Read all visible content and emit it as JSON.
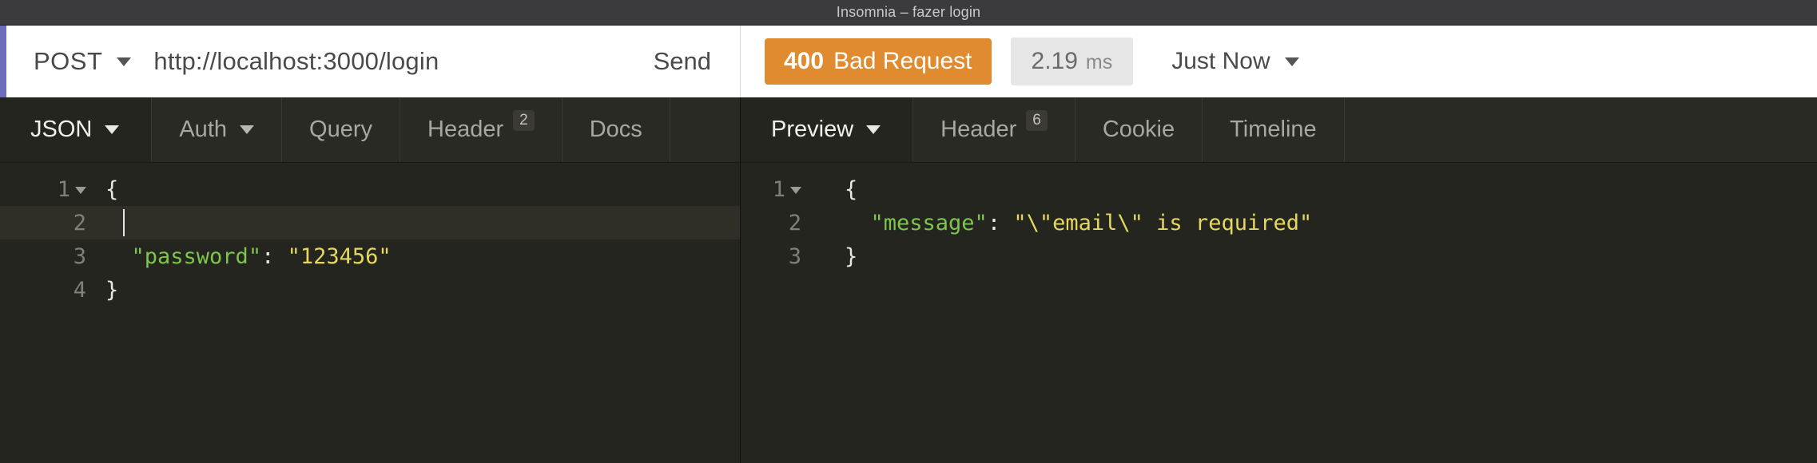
{
  "window": {
    "title": "Insomnia – fazer login"
  },
  "request_bar": {
    "method": "POST",
    "method_caret": "chevron-down-icon",
    "url": "http://localhost:3000/login",
    "send_label": "Send"
  },
  "response_meta": {
    "status_code": "400",
    "status_text": "Bad Request",
    "status_color": "#e08b2f",
    "time_value": "2.19",
    "time_unit": "ms",
    "history_label": "Just Now",
    "history_caret": "chevron-down-icon"
  },
  "request_tabs": [
    {
      "label": "JSON",
      "badge": "",
      "caret": true,
      "active": true
    },
    {
      "label": "Auth",
      "badge": "",
      "caret": true,
      "active": false
    },
    {
      "label": "Query",
      "badge": "",
      "caret": false,
      "active": false
    },
    {
      "label": "Header",
      "badge": "2",
      "caret": false,
      "active": false
    },
    {
      "label": "Docs",
      "badge": "",
      "caret": false,
      "active": false
    }
  ],
  "response_tabs": [
    {
      "label": "Preview",
      "badge": "",
      "caret": true,
      "active": true
    },
    {
      "label": "Header",
      "badge": "6",
      "caret": false,
      "active": false
    },
    {
      "label": "Cookie",
      "badge": "",
      "caret": false,
      "active": false
    },
    {
      "label": "Timeline",
      "badge": "",
      "caret": false,
      "active": false
    }
  ],
  "request_body": {
    "lines": [
      {
        "num": "1",
        "fold": true,
        "active": false,
        "indent": "",
        "open": "{",
        "key": "",
        "colon": "",
        "value": "",
        "cursor": false
      },
      {
        "num": "2",
        "fold": false,
        "active": true,
        "indent": "",
        "open": "",
        "key": "",
        "colon": "",
        "value": "",
        "cursor": true
      },
      {
        "num": "3",
        "fold": false,
        "active": false,
        "indent": "  ",
        "open": "",
        "key": "\"password\"",
        "colon": ":",
        "value": "\"123456\"",
        "cursor": false
      },
      {
        "num": "4",
        "fold": false,
        "active": false,
        "indent": "",
        "open": "}",
        "key": "",
        "colon": "",
        "value": "",
        "cursor": false
      }
    ]
  },
  "response_body": {
    "lines": [
      {
        "num": "1",
        "fold": true,
        "indent": "",
        "open": "{",
        "key": "",
        "colon": "",
        "value": ""
      },
      {
        "num": "2",
        "fold": false,
        "indent": "  ",
        "open": "",
        "key": "\"message\"",
        "colon": ":",
        "value": "\"\\\"email\\\" is required\""
      },
      {
        "num": "3",
        "fold": false,
        "indent": "",
        "open": "}",
        "key": "",
        "colon": "",
        "value": ""
      }
    ]
  }
}
